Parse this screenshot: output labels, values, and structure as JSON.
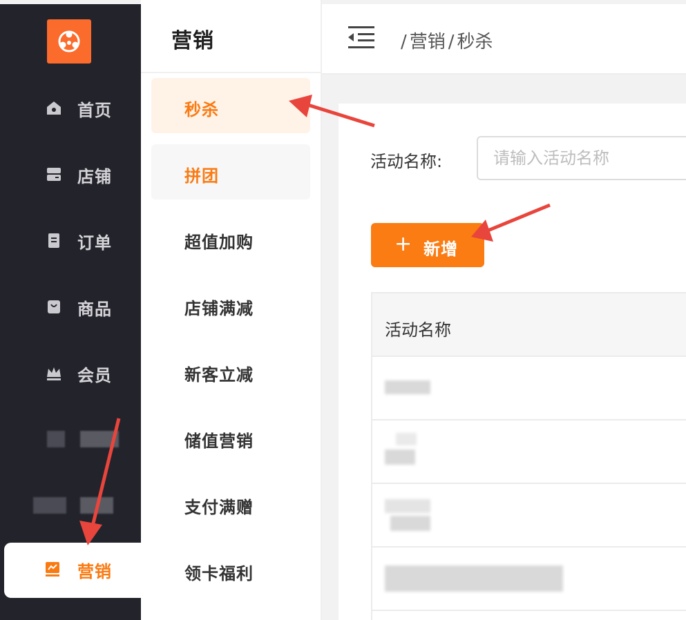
{
  "sidebar": {
    "items": [
      {
        "label": "首页",
        "icon": "home-icon"
      },
      {
        "label": "店铺",
        "icon": "store-icon"
      },
      {
        "label": "订单",
        "icon": "order-icon"
      },
      {
        "label": "商品",
        "icon": "goods-icon"
      },
      {
        "label": "会员",
        "icon": "crown-icon"
      }
    ],
    "active": {
      "label": "营销",
      "icon": "marketing-icon"
    }
  },
  "subpanel": {
    "title": "营销",
    "items": [
      "秒杀",
      "拼团",
      "超值加购",
      "店铺满减",
      "新客立减",
      "储值营销",
      "支付满赠",
      "领卡福利"
    ]
  },
  "header": {
    "breadcrumb": [
      "/",
      "营销",
      "/",
      "秒杀"
    ]
  },
  "filter": {
    "label": "活动名称:",
    "placeholder": "请输入活动名称"
  },
  "toolbar": {
    "add_icon": "+",
    "add_label": "新增"
  },
  "table": {
    "header": "活动名称"
  },
  "colors": {
    "accent": "#fa7c12",
    "sidebar_bg": "#23232b",
    "active_sub_bg": "#fff3e8",
    "annotation_arrow": "#e8453c"
  }
}
